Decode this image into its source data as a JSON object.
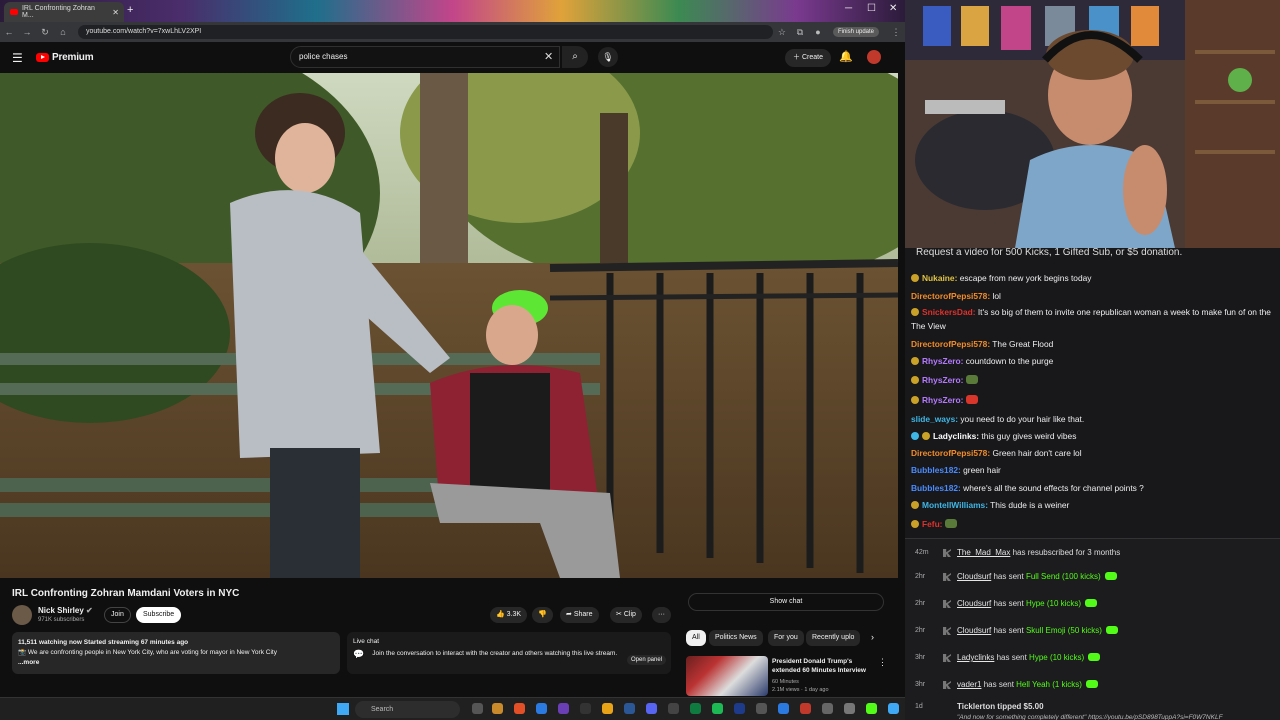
{
  "browser": {
    "tab_title": "IRL Confronting Zohran M...",
    "url": "youtube.com/watch?v=7xwLhLV2XPI",
    "finish_update": "Finish update"
  },
  "youtube": {
    "logo_text": "Premium",
    "search_value": "police chases",
    "create_label": "Create",
    "video_title": "IRL Confronting Zohran Mamdani Voters in NYC",
    "channel_name": "Nick Shirley",
    "subscribers": "971K subscribers",
    "join_label": "Join",
    "subscribe_label": "Subscribe",
    "likes": "3.3K",
    "share_label": "Share",
    "clip_label": "Clip",
    "more_label": "···",
    "watching": "11,511 watching now  Started streaming 67 minutes ago",
    "description": "📸 We are confronting people in New York City, who are voting for mayor in New York City",
    "more_link": "...more",
    "live_chat_title": "Live chat",
    "live_chat_text": "Join the conversation to interact with the creator and others watching this live stream.",
    "open_panel": "Open panel",
    "show_chat": "Show chat",
    "chips": [
      "All",
      "Politics News",
      "For you",
      "Recently uplo"
    ],
    "related": {
      "title": "President Donald Trump's extended 60 Minutes Interview",
      "channel": "60 Minutes",
      "meta": "2.1M views · 1 day ago"
    }
  },
  "taskbar": {
    "search_placeholder": "Search"
  },
  "chat": {
    "banner": "Request a video for 500 Kicks, 1 Gifted Sub, or $5 donation.",
    "messages": [
      {
        "user": "Nukaine:",
        "text": " escape from new york begins today",
        "color": "#e0c341"
      },
      {
        "user": "DirectorofPepsi578:",
        "text": " lol",
        "color": "#f28c28"
      },
      {
        "user": "SnickersDad:",
        "text": " It's so big of them to invite one republican woman a week to make fun of on the The View",
        "color": "#e0312b"
      },
      {
        "user": "DirectorofPepsi578:",
        "text": " The Great Flood",
        "color": "#f28c28"
      },
      {
        "user": "RhysZero:",
        "text": " countdown to the purge",
        "color": "#b57bff"
      },
      {
        "user": "RhysZero:",
        "text": "",
        "color": "#b57bff"
      },
      {
        "user": "RhysZero:",
        "text": "",
        "color": "#b57bff"
      },
      {
        "user": "slide_ways:",
        "text": " you need to do your hair like that.",
        "color": "#3fb7e6"
      },
      {
        "user": "Ladyclinks:",
        "text": " this guy gives weird vibes",
        "color": "#ffffff"
      },
      {
        "user": "DirectorofPepsi578:",
        "text": " Green hair don't care lol",
        "color": "#f28c28"
      },
      {
        "user": "Bubbles182:",
        "text": " green hair",
        "color": "#4a8cff"
      },
      {
        "user": "Bubbles182:",
        "text": " where's all the sound effects for channel points ?",
        "color": "#4a8cff"
      },
      {
        "user": "MontellWilliams:",
        "text": " This dude is a weiner",
        "color": "#3fb7e6"
      },
      {
        "user": "Fefu:",
        "text": "",
        "color": "#e0312b"
      }
    ]
  },
  "events": [
    {
      "time": "42m",
      "name": "The_Mad_Max",
      "action": " has resubscribed for 3 months",
      "item": ""
    },
    {
      "time": "2hr",
      "name": "Cloudsurf",
      "action": " has sent ",
      "item": "Full Send (100 kicks)"
    },
    {
      "time": "2hr",
      "name": "Cloudsurf",
      "action": " has sent ",
      "item": "Hype (10 kicks)"
    },
    {
      "time": "2hr",
      "name": "Cloudsurf",
      "action": " has sent ",
      "item": "Skull Emoji (50 kicks)"
    },
    {
      "time": "3hr",
      "name": "Ladyclinks",
      "action": " has sent ",
      "item": "Hype (10 kicks)"
    },
    {
      "time": "3hr",
      "name": "vader1",
      "action": " has sent ",
      "item": "Hell Yeah (1 kicks)"
    }
  ],
  "tip": {
    "time": "1d",
    "text": "Ticklerton tipped $5.00",
    "quote": "\"And now for something completely different\" https://youtu.be/pSD898TuppA?si=F0W7NKLF"
  }
}
